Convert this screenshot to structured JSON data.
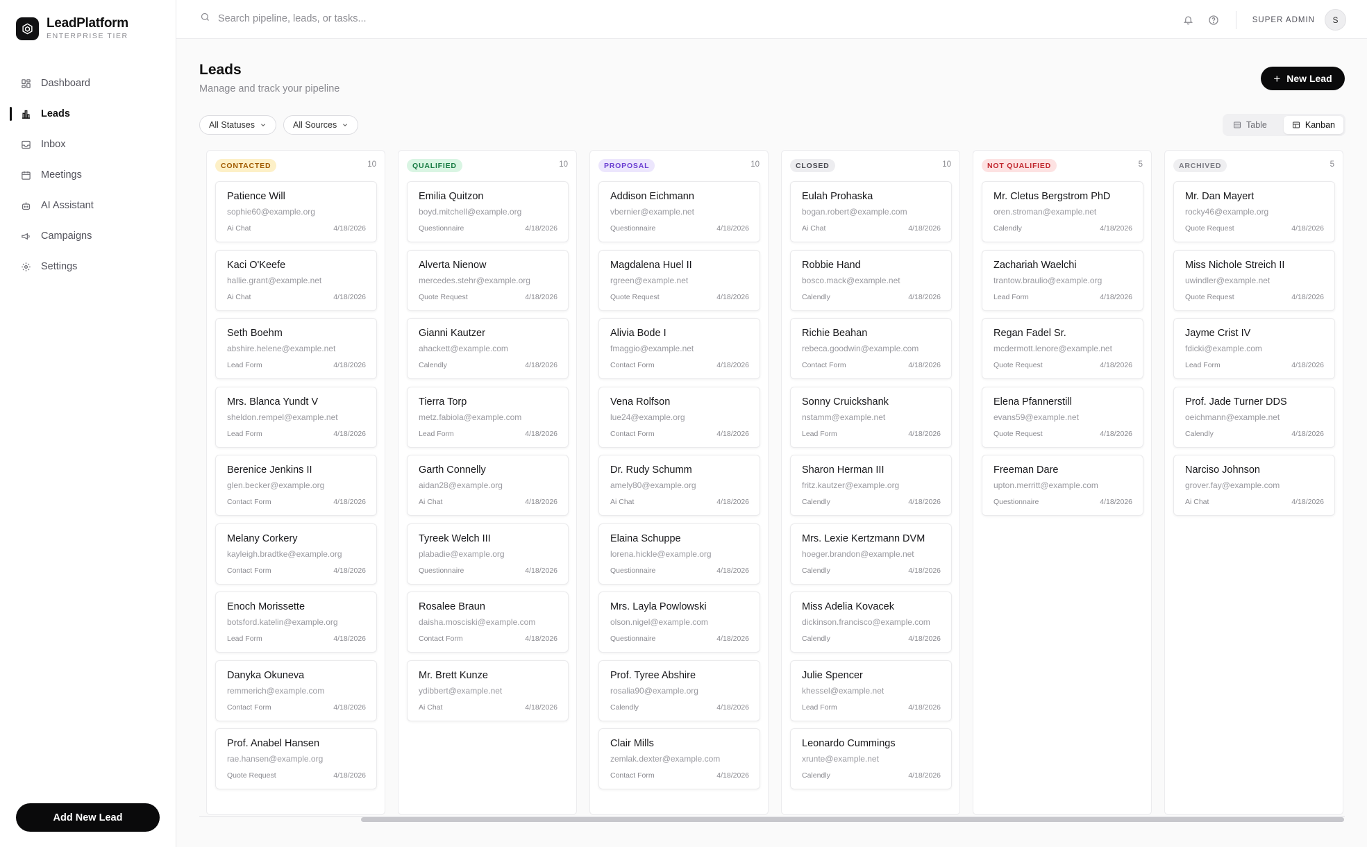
{
  "brand": {
    "name": "LeadPlatform",
    "tier": "ENTERPRISE TIER"
  },
  "nav": [
    {
      "label": "Dashboard",
      "icon": "dashboard-icon"
    },
    {
      "label": "Leads",
      "icon": "chart-bars-icon",
      "active": true
    },
    {
      "label": "Inbox",
      "icon": "inbox-icon"
    },
    {
      "label": "Meetings",
      "icon": "calendar-icon"
    },
    {
      "label": "AI Assistant",
      "icon": "bot-icon"
    },
    {
      "label": "Campaigns",
      "icon": "megaphone-icon"
    },
    {
      "label": "Settings",
      "icon": "gear-icon"
    }
  ],
  "sidebar_cta": "Add New Lead",
  "search": {
    "placeholder": "Search pipeline, leads, or tasks..."
  },
  "user": {
    "role": "SUPER ADMIN",
    "initial": "S"
  },
  "page": {
    "title": "Leads",
    "subtitle": "Manage and track your pipeline",
    "new_button": "New Lead"
  },
  "filters": {
    "status": "All Statuses",
    "source": "All Sources"
  },
  "views": {
    "table": "Table",
    "kanban": "Kanban",
    "active": "Kanban"
  },
  "colors": {
    "accent": "#0a0a0b"
  },
  "columns": [
    {
      "status": "CONTACTED",
      "count": "10",
      "badge_bg": "#fdf0c7",
      "badge_fg": "#a05a00",
      "leads": [
        {
          "name": "Patience Will",
          "email": "sophie60@example.org",
          "source": "Ai Chat",
          "date": "4/18/2026"
        },
        {
          "name": "Kaci O'Keefe",
          "email": "hallie.grant@example.net",
          "source": "Ai Chat",
          "date": "4/18/2026"
        },
        {
          "name": "Seth Boehm",
          "email": "abshire.helene@example.net",
          "source": "Lead Form",
          "date": "4/18/2026"
        },
        {
          "name": "Mrs. Blanca Yundt V",
          "email": "sheldon.rempel@example.net",
          "source": "Lead Form",
          "date": "4/18/2026"
        },
        {
          "name": "Berenice Jenkins II",
          "email": "glen.becker@example.org",
          "source": "Contact Form",
          "date": "4/18/2026"
        },
        {
          "name": "Melany Corkery",
          "email": "kayleigh.bradtke@example.org",
          "source": "Contact Form",
          "date": "4/18/2026"
        },
        {
          "name": "Enoch Morissette",
          "email": "botsford.katelin@example.org",
          "source": "Lead Form",
          "date": "4/18/2026"
        },
        {
          "name": "Danyka Okuneva",
          "email": "remmerich@example.com",
          "source": "Contact Form",
          "date": "4/18/2026"
        },
        {
          "name": "Prof. Anabel Hansen",
          "email": "rae.hansen@example.org",
          "source": "Quote Request",
          "date": "4/18/2026"
        }
      ]
    },
    {
      "status": "QUALIFIED",
      "count": "10",
      "badge_bg": "#d9f5e3",
      "badge_fg": "#177a42",
      "leads": [
        {
          "name": "Emilia Quitzon",
          "email": "boyd.mitchell@example.org",
          "source": "Questionnaire",
          "date": "4/18/2026"
        },
        {
          "name": "Alverta Nienow",
          "email": "mercedes.stehr@example.org",
          "source": "Quote Request",
          "date": "4/18/2026"
        },
        {
          "name": "Gianni Kautzer",
          "email": "ahackett@example.com",
          "source": "Calendly",
          "date": "4/18/2026"
        },
        {
          "name": "Tierra Torp",
          "email": "metz.fabiola@example.com",
          "source": "Lead Form",
          "date": "4/18/2026"
        },
        {
          "name": "Garth Connelly",
          "email": "aidan28@example.org",
          "source": "Ai Chat",
          "date": "4/18/2026"
        },
        {
          "name": "Tyreek Welch III",
          "email": "plabadie@example.org",
          "source": "Questionnaire",
          "date": "4/18/2026"
        },
        {
          "name": "Rosalee Braun",
          "email": "daisha.mosciski@example.com",
          "source": "Contact Form",
          "date": "4/18/2026"
        },
        {
          "name": "Mr. Brett Kunze",
          "email": "ydibbert@example.net",
          "source": "Ai Chat",
          "date": "4/18/2026"
        }
      ]
    },
    {
      "status": "PROPOSAL",
      "count": "10",
      "badge_bg": "#ece6fd",
      "badge_fg": "#6b3fd1",
      "leads": [
        {
          "name": "Addison Eichmann",
          "email": "vbernier@example.net",
          "source": "Questionnaire",
          "date": "4/18/2026"
        },
        {
          "name": "Magdalena Huel II",
          "email": "rgreen@example.net",
          "source": "Quote Request",
          "date": "4/18/2026"
        },
        {
          "name": "Alivia Bode I",
          "email": "fmaggio@example.net",
          "source": "Contact Form",
          "date": "4/18/2026"
        },
        {
          "name": "Vena Rolfson",
          "email": "lue24@example.org",
          "source": "Contact Form",
          "date": "4/18/2026"
        },
        {
          "name": "Dr. Rudy Schumm",
          "email": "amely80@example.org",
          "source": "Ai Chat",
          "date": "4/18/2026"
        },
        {
          "name": "Elaina Schuppe",
          "email": "lorena.hickle@example.org",
          "source": "Questionnaire",
          "date": "4/18/2026"
        },
        {
          "name": "Mrs. Layla Powlowski",
          "email": "olson.nigel@example.com",
          "source": "Questionnaire",
          "date": "4/18/2026"
        },
        {
          "name": "Prof. Tyree Abshire",
          "email": "rosalia90@example.org",
          "source": "Calendly",
          "date": "4/18/2026"
        },
        {
          "name": "Clair Mills",
          "email": "zemlak.dexter@example.com",
          "source": "Contact Form",
          "date": "4/18/2026"
        }
      ]
    },
    {
      "status": "CLOSED",
      "count": "10",
      "badge_bg": "#ededf0",
      "badge_fg": "#4b4b52",
      "leads": [
        {
          "name": "Eulah Prohaska",
          "email": "bogan.robert@example.com",
          "source": "Ai Chat",
          "date": "4/18/2026"
        },
        {
          "name": "Robbie Hand",
          "email": "bosco.mack@example.net",
          "source": "Calendly",
          "date": "4/18/2026"
        },
        {
          "name": "Richie Beahan",
          "email": "rebeca.goodwin@example.com",
          "source": "Contact Form",
          "date": "4/18/2026"
        },
        {
          "name": "Sonny Cruickshank",
          "email": "nstamm@example.net",
          "source": "Lead Form",
          "date": "4/18/2026"
        },
        {
          "name": "Sharon Herman III",
          "email": "fritz.kautzer@example.org",
          "source": "Calendly",
          "date": "4/18/2026"
        },
        {
          "name": "Mrs. Lexie Kertzmann DVM",
          "email": "hoeger.brandon@example.net",
          "source": "Calendly",
          "date": "4/18/2026"
        },
        {
          "name": "Miss Adelia Kovacek",
          "email": "dickinson.francisco@example.com",
          "source": "Calendly",
          "date": "4/18/2026"
        },
        {
          "name": "Julie Spencer",
          "email": "khessel@example.net",
          "source": "Lead Form",
          "date": "4/18/2026"
        },
        {
          "name": "Leonardo Cummings",
          "email": "xrunte@example.net",
          "source": "Calendly",
          "date": "4/18/2026"
        }
      ]
    },
    {
      "status": "NOT QUALIFIED",
      "count": "5",
      "badge_bg": "#fde2e2",
      "badge_fg": "#c0262d",
      "leads": [
        {
          "name": "Mr. Cletus Bergstrom PhD",
          "email": "oren.stroman@example.net",
          "source": "Calendly",
          "date": "4/18/2026"
        },
        {
          "name": "Zachariah Waelchi",
          "email": "trantow.braulio@example.org",
          "source": "Lead Form",
          "date": "4/18/2026"
        },
        {
          "name": "Regan Fadel Sr.",
          "email": "mcdermott.lenore@example.net",
          "source": "Quote Request",
          "date": "4/18/2026"
        },
        {
          "name": "Elena Pfannerstill",
          "email": "evans59@example.net",
          "source": "Quote Request",
          "date": "4/18/2026"
        },
        {
          "name": "Freeman Dare",
          "email": "upton.merritt@example.com",
          "source": "Questionnaire",
          "date": "4/18/2026"
        }
      ]
    },
    {
      "status": "ARCHIVED",
      "count": "5",
      "badge_bg": "#efeff1",
      "badge_fg": "#7a7a82",
      "leads": [
        {
          "name": "Mr. Dan Mayert",
          "email": "rocky46@example.org",
          "source": "Quote Request",
          "date": "4/18/2026"
        },
        {
          "name": "Miss Nichole Streich II",
          "email": "uwindler@example.net",
          "source": "Quote Request",
          "date": "4/18/2026"
        },
        {
          "name": "Jayme Crist IV",
          "email": "fdicki@example.com",
          "source": "Lead Form",
          "date": "4/18/2026"
        },
        {
          "name": "Prof. Jade Turner DDS",
          "email": "oeichmann@example.net",
          "source": "Calendly",
          "date": "4/18/2026"
        },
        {
          "name": "Narciso Johnson",
          "email": "grover.fay@example.com",
          "source": "Ai Chat",
          "date": "4/18/2026"
        }
      ]
    }
  ]
}
